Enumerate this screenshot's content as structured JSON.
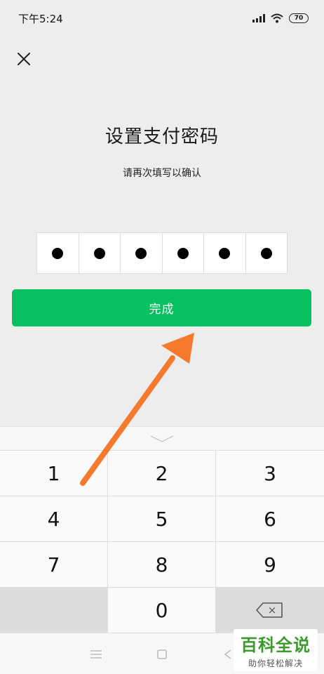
{
  "status_bar": {
    "time": "下午5:24",
    "battery": "70"
  },
  "page": {
    "title": "设置支付密码",
    "subtitle": "请再次填写以确认",
    "done_label": "完成"
  },
  "keypad": {
    "keys": [
      "1",
      "2",
      "3",
      "4",
      "5",
      "6",
      "7",
      "8",
      "9",
      "",
      "0",
      ""
    ],
    "backspace_symbol": "×"
  },
  "watermark": {
    "main": "百科全说",
    "sub": "助你轻松解决"
  },
  "colors": {
    "accent": "#07c160",
    "arrow": "#f57a2e"
  }
}
